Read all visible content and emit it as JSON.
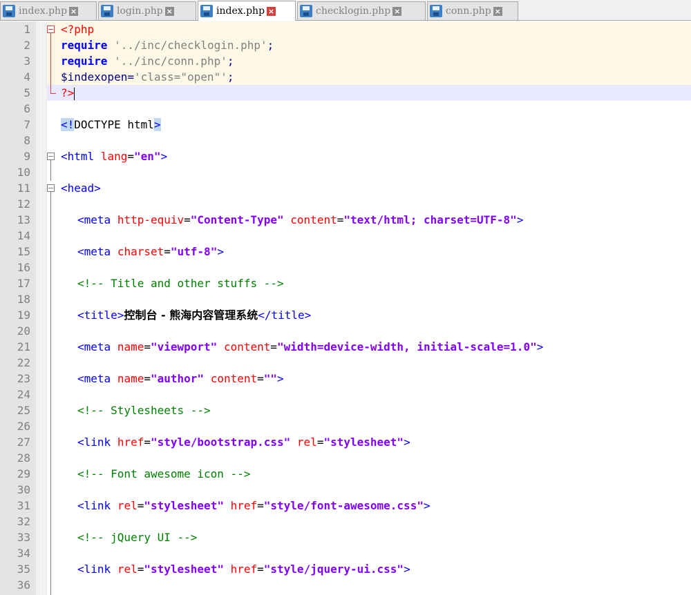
{
  "tabs": [
    {
      "label": "index.php",
      "active": false
    },
    {
      "label": "login.php",
      "active": false
    },
    {
      "label": "index.php",
      "active": true
    },
    {
      "label": "checklogin.php",
      "active": false
    },
    {
      "label": "conn.php",
      "active": false
    }
  ],
  "line_numbers": [
    "1",
    "2",
    "3",
    "4",
    "5",
    "6",
    "7",
    "8",
    "9",
    "10",
    "11",
    "12",
    "13",
    "14",
    "15",
    "16",
    "17",
    "18",
    "19",
    "20",
    "21",
    "22",
    "23",
    "24",
    "25",
    "26",
    "27",
    "28",
    "29",
    "30",
    "31",
    "32",
    "33",
    "34",
    "35",
    "36"
  ],
  "code": {
    "l1": {
      "open": "<?php"
    },
    "l2": {
      "kw": "require",
      "str": "'../inc/checklogin.php'",
      "semi": ";"
    },
    "l3": {
      "kw": "require",
      "str": "'../inc/conn.php'",
      "semi": ";"
    },
    "l4": {
      "var": "$indexopen",
      "eq": "=",
      "str": "'class=\"open\"'",
      "semi": ";"
    },
    "l5": {
      "close": "?>"
    },
    "l7": {
      "lt": "<",
      "bang": "!",
      "text": "DOCTYPE html",
      "gt": ">"
    },
    "l9": {
      "tag": "<html",
      "attr": "lang",
      "eq": "=",
      "val": "\"en\"",
      "end": ">"
    },
    "l11": {
      "tag": "<head>"
    },
    "l13": {
      "tag": "<meta",
      "a1": "http-equiv",
      "eq": "=",
      "v1": "\"Content-Type\"",
      "a2": "content",
      "v2": "\"text/html; charset=UTF-8\"",
      "end": ">"
    },
    "l15": {
      "tag": "<meta",
      "a1": "charset",
      "eq": "=",
      "v1": "\"utf-8\"",
      "end": ">"
    },
    "l17": {
      "comment": "<!-- Title and other stuffs -->"
    },
    "l19": {
      "open": "<title>",
      "text": "控制台 - 熊海内容管理系统",
      "close": "</title>"
    },
    "l21": {
      "tag": "<meta",
      "a1": "name",
      "eq": "=",
      "v1": "\"viewport\"",
      "a2": "content",
      "v2": "\"width=device-width, initial-scale=1.0\"",
      "end": ">"
    },
    "l23": {
      "tag": "<meta",
      "a1": "name",
      "eq": "=",
      "v1": "\"author\"",
      "a2": "content",
      "v2": "\"\"",
      "end": ">"
    },
    "l25": {
      "comment": "<!-- Stylesheets -->"
    },
    "l27": {
      "tag": "<link",
      "a1": "href",
      "eq": "=",
      "v1": "\"style/bootstrap.css\"",
      "a2": "rel",
      "v2": "\"stylesheet\"",
      "end": ">"
    },
    "l29": {
      "comment": "<!-- Font awesome icon -->"
    },
    "l31": {
      "tag": "<link",
      "a1": "rel",
      "eq": "=",
      "v1": "\"stylesheet\"",
      "a2": "href",
      "v2": "\"style/font-awesome.css\"",
      "end": ">"
    },
    "l33": {
      "comment": "<!-- jQuery UI -->"
    },
    "l35": {
      "tag": "<link",
      "a1": "rel",
      "eq": "=",
      "v1": "\"stylesheet\"",
      "a2": "href",
      "v2": "\"style/jquery-ui.css\"",
      "end": ">"
    }
  },
  "colors": {
    "php_block_bg": "#fdf8e6",
    "current_line_bg": "#e8e8ff",
    "gutter_bg": "#e4e4e4"
  }
}
